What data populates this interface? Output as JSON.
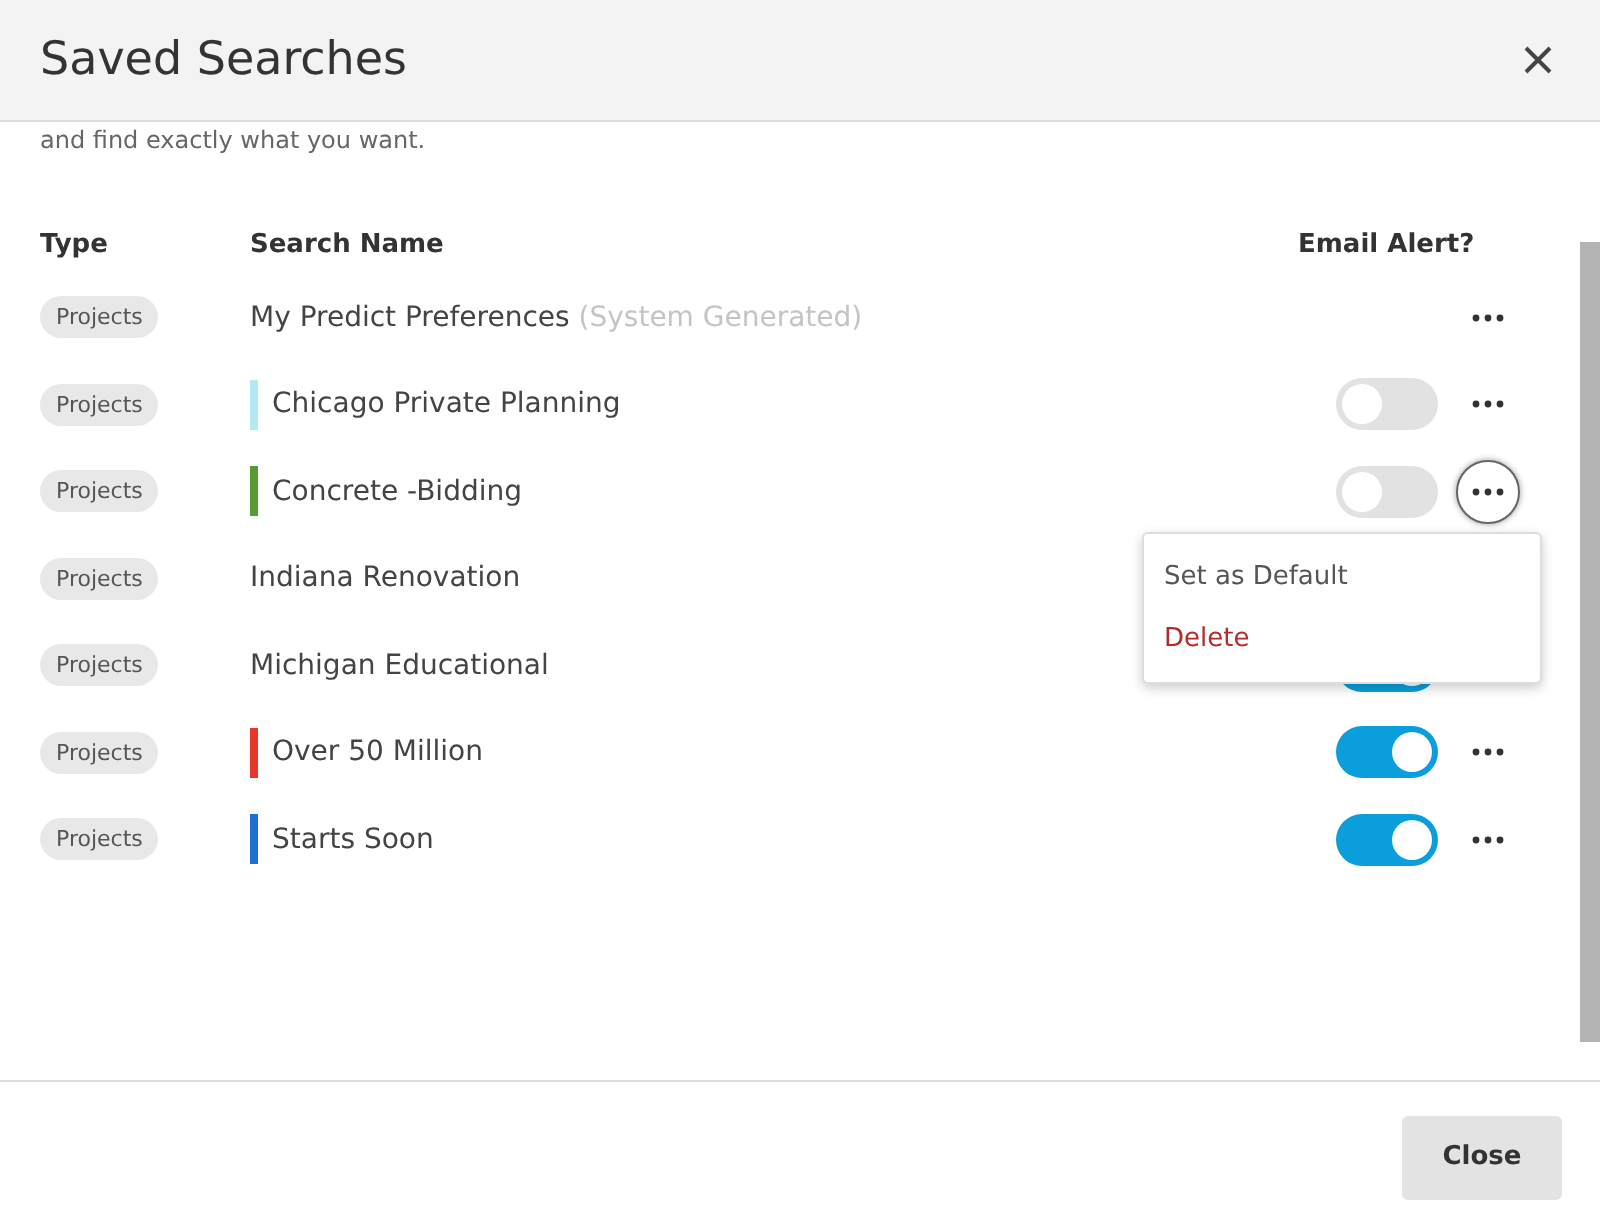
{
  "dialog": {
    "title": "Saved Searches",
    "intro": "and find exactly what you want."
  },
  "table": {
    "columns": [
      "Type",
      "Search Name",
      "Email Alert?"
    ],
    "rows": [
      {
        "type": "Projects",
        "name": "My Predict Preferences",
        "note": "(System Generated)",
        "kind": "system",
        "menu_open": false
      },
      {
        "type": "Projects",
        "name": "Chicago Private Planning",
        "color": "#b3e9f2",
        "kind": "alert",
        "alert_on": false,
        "menu_open": false
      },
      {
        "type": "Projects",
        "name": "Concrete -Bidding",
        "color": "#5a9a32",
        "kind": "alert",
        "alert_on": false,
        "menu_open": true
      },
      {
        "type": "Projects",
        "name": "Indiana Renovation",
        "kind": "plain",
        "menu_open": false
      },
      {
        "type": "Projects",
        "name": "Michigan Educational",
        "kind": "alert",
        "alert_on": true,
        "menu_open": false
      },
      {
        "type": "Projects",
        "name": "Over 50 Million",
        "color": "#e8362c",
        "kind": "alert",
        "alert_on": true,
        "menu_open": false
      },
      {
        "type": "Projects",
        "name": "Starts Soon",
        "color": "#1d6fd1",
        "kind": "alert",
        "alert_on": true,
        "menu_open": false
      }
    ]
  },
  "row_menu": {
    "items": [
      {
        "label": "Set as Default",
        "kind": "normal"
      },
      {
        "label": "Delete",
        "kind": "danger"
      }
    ]
  },
  "footer": {
    "buttons": [
      "Close"
    ]
  }
}
